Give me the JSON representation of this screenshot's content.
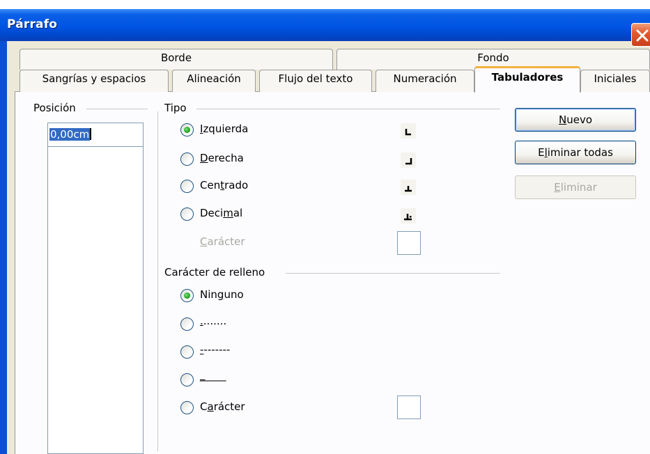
{
  "window": {
    "title": "Párrafo"
  },
  "tabs_row1": [
    {
      "label": "Borde"
    },
    {
      "label": "Fondo"
    }
  ],
  "tabs_row2": [
    {
      "label": "Sangrías y espacios"
    },
    {
      "label": "Alineación"
    },
    {
      "label": "Flujo del texto"
    },
    {
      "label": "Numeración"
    },
    {
      "label": "Tabuladores",
      "active": true
    },
    {
      "label": "Iniciales"
    }
  ],
  "position": {
    "label": "Posición",
    "value": "0,00cm"
  },
  "tipo": {
    "label": "Tipo",
    "options": [
      {
        "pre": "",
        "key": "I",
        "post": "zquierda",
        "selected": true,
        "icon": "tab-left-icon"
      },
      {
        "pre": "",
        "key": "D",
        "post": "erecha",
        "selected": false,
        "icon": "tab-right-icon"
      },
      {
        "pre": "Cen",
        "key": "t",
        "post": "rado",
        "selected": false,
        "icon": "tab-center-icon"
      },
      {
        "pre": "Deci",
        "key": "m",
        "post": "al",
        "selected": false,
        "icon": "tab-decimal-icon"
      }
    ],
    "character": {
      "pre": "",
      "key": "C",
      "post": "arácter"
    }
  },
  "relleno": {
    "label": "Carácter de relleno",
    "options": [
      {
        "pre": "Nin",
        "key": "g",
        "post": "uno",
        "selected": true
      },
      {
        "pre": "",
        "key": ".",
        "post": ".......",
        "selected": false
      },
      {
        "pre": "",
        "key": "-",
        "post": "-------",
        "selected": false
      },
      {
        "pre": "",
        "key": "_",
        "post": "____",
        "selected": false
      },
      {
        "pre": "C",
        "key": "a",
        "post": "rácter",
        "selected": false
      }
    ]
  },
  "buttons": {
    "nuevo": {
      "pre": "",
      "key": "N",
      "post": "uevo"
    },
    "eliminar_todas": {
      "pre": "E",
      "key": "l",
      "post": "iminar todas"
    },
    "eliminar": {
      "pre": "",
      "key": "E",
      "post": "liminar"
    }
  },
  "colors": {
    "titlebar": "#0054e3",
    "active_tab_accent": "#f4b03c",
    "radio_dot": "#21a121"
  }
}
